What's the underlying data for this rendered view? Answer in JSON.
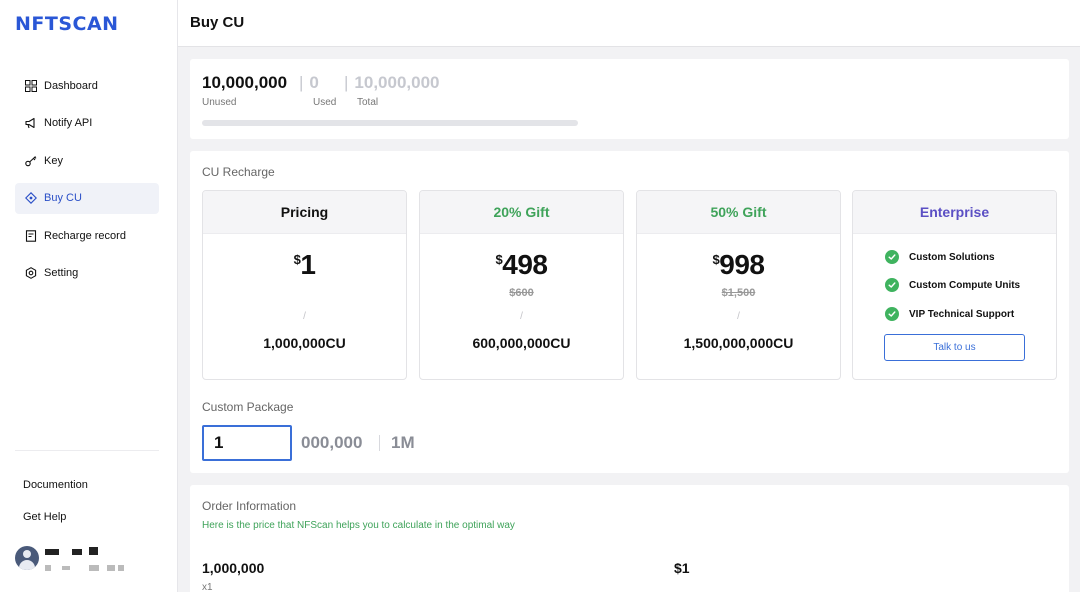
{
  "brand": {
    "logo_text": "NFTSCAN",
    "accent": "#2a57d6",
    "green": "#3fb35f",
    "purple": "#5b4fc4"
  },
  "sidebar": {
    "items": [
      {
        "label": "Dashboard",
        "icon": "grid-icon",
        "active": false
      },
      {
        "label": "Notify API",
        "icon": "megaphone-icon",
        "active": false
      },
      {
        "label": "Key",
        "icon": "key-icon",
        "active": false
      },
      {
        "label": "Buy CU",
        "icon": "diamond-tag-icon",
        "active": true
      },
      {
        "label": "Recharge record",
        "icon": "receipt-icon",
        "active": false
      },
      {
        "label": "Setting",
        "icon": "settings-hex-icon",
        "active": false
      }
    ],
    "documention": "Documention",
    "get_help": "Get Help"
  },
  "header": {
    "title": "Buy CU"
  },
  "usage": {
    "unused_value": "10,000,000",
    "unused_label": "Unused",
    "used_value": "0",
    "used_label": "Used",
    "total_value": "10,000,000",
    "total_label": "Total",
    "used_fraction": 0
  },
  "recharge": {
    "title": "CU Recharge",
    "plans": [
      {
        "name": "Pricing",
        "name_color": "#111111",
        "currency": "$",
        "price": "1",
        "old_price": "",
        "slash": "/",
        "amount": "1,000,000CU"
      },
      {
        "name": "20% Gift",
        "name_color": "#3fa35a",
        "currency": "$",
        "price": "498",
        "old_price": "$600",
        "slash": "/",
        "amount": "600,000,000CU"
      },
      {
        "name": "50% Gift",
        "name_color": "#3fa35a",
        "currency": "$",
        "price": "998",
        "old_price": "$1,500",
        "slash": "/",
        "amount": "1,500,000,000CU"
      }
    ],
    "enterprise": {
      "name": "Enterprise",
      "features": [
        "Custom Solutions",
        "Custom Compute Units",
        "VIP Technical Support"
      ],
      "button": "Talk to us"
    }
  },
  "custom_package": {
    "title": "Custom Package",
    "value": "1",
    "suffix": "000,000",
    "unit": "1M"
  },
  "order": {
    "title": "Order Information",
    "note": "Here is the price that NFScan helps you to calculate in the optimal way",
    "amount": "1,000,000",
    "multiplier": "x1",
    "price": "$1"
  }
}
